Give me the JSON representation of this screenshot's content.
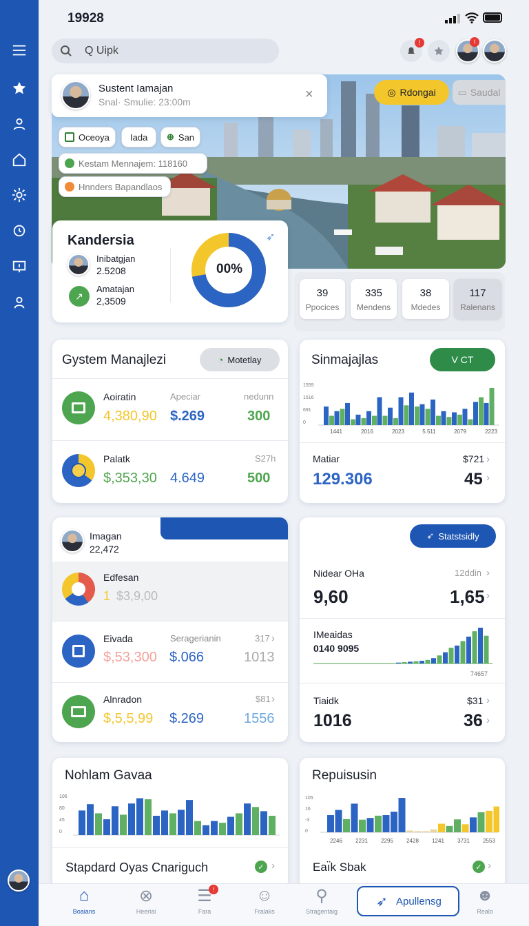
{
  "status": {
    "time": "19928"
  },
  "search": {
    "placeholder": "Q Uipk"
  },
  "header": {
    "badge1": "!",
    "badge2": "!"
  },
  "hero": {
    "person_name": "Sustent Iamajan",
    "person_sub": "Snal· Smulie: 23:00m",
    "chips": [
      "Oceoya",
      "Iada",
      "San"
    ],
    "info1": "Kestam Mennajem: 118160",
    "info2": "Hnnders Bapandlaos",
    "btn_primary": "Rdongai",
    "btn_secondary": "Saudal"
  },
  "kandersia": {
    "title": "Kandersia",
    "rows": [
      {
        "label": "Inibatgjan",
        "value": "2.5208"
      },
      {
        "label": "Amatajan",
        "value": "2,3509"
      }
    ],
    "donut_label": "00%",
    "donut_share": 0.72
  },
  "stats": [
    {
      "value": "39",
      "label": "Ppocices"
    },
    {
      "value": "335",
      "label": "Mendens"
    },
    {
      "value": "38",
      "label": "Mdedes"
    },
    {
      "value": "117",
      "label": "Ralenans"
    }
  ],
  "gystem": {
    "title": "Gystem Manajlezi",
    "button": "Motetlay",
    "rows": [
      {
        "name": "Aoiratin",
        "sub": "Apeciar",
        "sub2": "nedunn",
        "v1": "4,380,90",
        "v2": "$.269",
        "v3": "300"
      },
      {
        "name": "Palatk",
        "sub": "",
        "sub2": "S27h",
        "v1": "$,353,30",
        "v2": "4.649",
        "v3": "500"
      }
    ]
  },
  "sinma": {
    "title": "Sinmajajlas",
    "button": "V CT",
    "y_ticks": [
      "1559",
      "1516",
      "691",
      "0"
    ],
    "x_ticks": [
      "1441",
      "2016",
      "2023",
      "5.511",
      "2079",
      "2223"
    ],
    "row_label": "Matiar",
    "row_value": "129.306",
    "row_right_label": "$721",
    "row_right_value": "45"
  },
  "imagan": {
    "person": "Imagan",
    "value": "22,472",
    "rows": [
      {
        "name": "Edfesan",
        "sub": "",
        "sub2": "",
        "v1": "1",
        "v1b": "$3,9,00",
        "v2": "",
        "v3": ""
      },
      {
        "name": "Eivada",
        "sub": "Seragerianin",
        "sub2": "317",
        "v1": "$,53,300",
        "v2": "$.066",
        "v3": "1013"
      },
      {
        "name": "Alnradon",
        "sub": "",
        "sub2": "$81",
        "v1": "$,5,5,99",
        "v2": "$.269",
        "v3": "1556"
      }
    ]
  },
  "statsbox": {
    "button": "Statstsidly",
    "r1_label": "Nidear OHa",
    "r1_value": "9,60",
    "r1_right_label": "12ddin",
    "r1_right_value": "1,65",
    "r2_label": "IMeaidas",
    "r2_value": "0140 9095",
    "r2_axis": "74657",
    "r3_label": "Tiaidk",
    "r3_value": "1016",
    "r3_right_label": "$31",
    "r3_right_value": "36"
  },
  "nohlam": {
    "title": "Nohlam Gavaa",
    "y_ticks": [
      "106",
      "80",
      "45",
      "0"
    ],
    "footer": "Stapdard Oyas Cnariguch"
  },
  "repuisusin": {
    "title": "Repuisusin",
    "y_ticks": [
      "105",
      "16",
      "-3",
      "0"
    ],
    "x_ticks": [
      "2246",
      "2231",
      "2295",
      "2428",
      "1241",
      "3731",
      "2553"
    ],
    "footer": "Eaı̈k Sbak"
  },
  "chart_data": [
    {
      "type": "bar",
      "title": "Sinmajajlas",
      "series": [
        {
          "name": "",
          "color": "#2c64c4",
          "values": [
            80,
            60,
            95,
            45,
            60,
            120,
            75,
            120,
            140,
            90,
            110,
            60,
            55,
            70,
            100,
            95
          ]
        },
        {
          "name": "",
          "color": "#5fb063",
          "values": [
            40,
            70,
            25,
            30,
            40,
            40,
            30,
            85,
            80,
            70,
            40,
            35,
            45,
            25,
            120,
            160
          ]
        }
      ],
      "ylim": [
        0,
        1559
      ]
    },
    {
      "type": "bar",
      "title": "IMeaidas",
      "values": [
        2,
        3,
        4,
        5,
        6,
        8,
        12,
        18,
        25,
        35,
        40,
        50,
        60,
        72,
        80,
        62
      ],
      "colors": [
        "blue",
        "green"
      ]
    },
    {
      "type": "bar",
      "title": "Nohlam Gavaa",
      "values": [
        70,
        88,
        62,
        45,
        82,
        58,
        90,
        105,
        102,
        55,
        70,
        62,
        72,
        100,
        40,
        28,
        40,
        35,
        52,
        62,
        90,
        80,
        68,
        55
      ],
      "ylim": [
        0,
        106
      ]
    },
    {
      "type": "bar",
      "title": "Repuisusin",
      "values": [
        60,
        78,
        46,
        100,
        44,
        50,
        58,
        60,
        72,
        120,
        6,
        4,
        4,
        10,
        30,
        22,
        45,
        28,
        52,
        70,
        75,
        90
      ],
      "ylim": [
        0,
        105
      ]
    }
  ],
  "bottom_nav": [
    {
      "label": "Boaians",
      "icon": "home-icon"
    },
    {
      "label": "Heeriai",
      "icon": "close-circle-icon"
    },
    {
      "label": "Fara",
      "icon": "list-icon",
      "badge": "!"
    },
    {
      "label": "Fralaks",
      "icon": "user-icon"
    },
    {
      "label": "Stragentaig",
      "icon": "search-icon"
    },
    {
      "label": "Apullensg",
      "icon": "send-icon"
    },
    {
      "label": "Realo",
      "icon": "profile-icon"
    }
  ],
  "colors": {
    "primary": "#1e56b3",
    "green": "#4ea54f",
    "yellow": "#f1c232",
    "blue": "#2c64c4"
  }
}
